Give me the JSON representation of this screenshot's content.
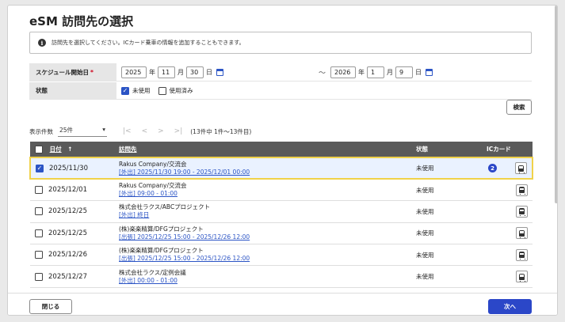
{
  "dialog": {
    "title": "eSM 訪問先の選択",
    "info": "訪問先を選択してください。ICカード乗車の情報を追加することもできます。",
    "info_icon": "info-icon"
  },
  "form": {
    "schedule_label": "スケジュール開始日",
    "required_mark": "*",
    "from": {
      "year": "2025",
      "month": "11",
      "day": "30"
    },
    "to": {
      "year": "2026",
      "month": "1",
      "day": "9"
    },
    "unit_year": "年",
    "unit_month": "月",
    "unit_day": "日",
    "tilde": "～",
    "status_label": "状態",
    "status_unused": "未使用",
    "status_unused_checked": true,
    "status_used": "使用済み",
    "status_used_checked": false
  },
  "buttons": {
    "search": "検索",
    "close": "閉じる",
    "next": "次へ"
  },
  "pager": {
    "per_page_label": "表示件数",
    "per_page_value": "25件",
    "info": "(13件中 1件～13件目)",
    "first": "|<",
    "prev": "<",
    "next": ">",
    "last": ">|"
  },
  "table": {
    "headers": {
      "date": "日付",
      "sort_icon": "↑",
      "destination": "訪問先",
      "status": "状態",
      "ic": "ICカード"
    },
    "rows": [
      {
        "date": "2025/11/30",
        "checked": true,
        "name": "Rakus Company/交流会",
        "link": "[外出] 2025/11/30 19:00 - 2025/12/01 00:00",
        "status": "未使用",
        "ic_count": "2"
      },
      {
        "date": "2025/12/01",
        "checked": false,
        "name": "Rakus Company/交流会",
        "link": "[外出] 09:00 - 01:00",
        "status": "未使用",
        "ic_count": ""
      },
      {
        "date": "2025/12/25",
        "checked": false,
        "name": "株式会社ラクス/ABCプロジェクト",
        "link": "[外出] 終日",
        "status": "未使用",
        "ic_count": ""
      },
      {
        "date": "2025/12/25",
        "checked": false,
        "name": "(株)楽楽精算/DFGプロジェクト",
        "link": "[出張] 2025/12/25 15:00 - 2025/12/26 12:00",
        "status": "未使用",
        "ic_count": ""
      },
      {
        "date": "2025/12/26",
        "checked": false,
        "name": "(株)楽楽精算/DFGプロジェクト",
        "link": "[出張] 2025/12/25 15:00 - 2025/12/26 12:00",
        "status": "未使用",
        "ic_count": ""
      },
      {
        "date": "2025/12/27",
        "checked": false,
        "name": "株式会社ラクス/定例会議",
        "link": "[外出] 00:00 - 01:00",
        "status": "未使用",
        "ic_count": ""
      }
    ]
  },
  "colors": {
    "accent": "#2b47c8",
    "header_bg": "#5a5a5a",
    "selected_border": "#f0d24a",
    "selected_bg": "#eaf2ff"
  }
}
